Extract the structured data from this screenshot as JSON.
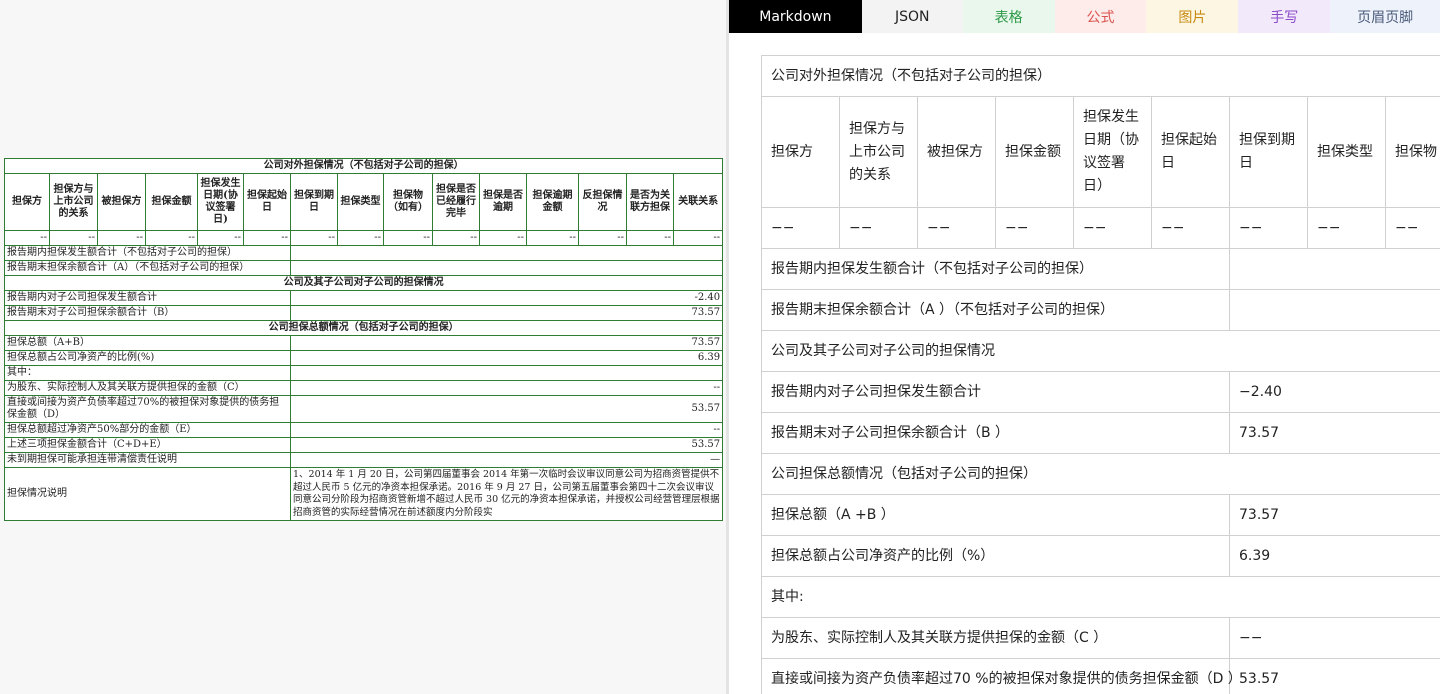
{
  "left": {
    "title": "公司对外担保情况（不包括对子公司的担保）",
    "headers": [
      "担保方",
      "担保方与上市公司的关系",
      "被担保方",
      "担保金额",
      "担保发生日期(协议签署日)",
      "担保起始日",
      "担保到期日",
      "担保类型",
      "担保物（如有）",
      "担保是否已经履行完毕",
      "担保是否逾期",
      "担保逾期金额",
      "反担保情况",
      "是否为关联方担保",
      "关联关系"
    ],
    "dash": "--",
    "rows": [
      {
        "label": "报告期内担保发生额合计（不包括对子公司的担保）",
        "value": ""
      },
      {
        "label": "报告期末担保余额合计（A）（不包括对子公司的担保）",
        "value": ""
      }
    ],
    "sub_title": "公司及其子公司对子公司的担保情况",
    "sub_rows": [
      {
        "label": "报告期内对子公司担保发生额合计",
        "value": "-2.40"
      },
      {
        "label": "报告期末对子公司担保余额合计（B）",
        "value": "73.57"
      }
    ],
    "total_title": "公司担保总额情况（包括对子公司的担保）",
    "total_rows": [
      {
        "label": "担保总额（A+B）",
        "value": "73.57"
      },
      {
        "label": "担保总额占公司净资产的比例(%)",
        "value": "6.39"
      },
      {
        "label": "其中：",
        "value": ""
      },
      {
        "label": "为股东、实际控制人及其关联方提供担保的金额（C）",
        "value": "--"
      },
      {
        "label": "直接或间接为资产负债率超过70%的被担保对象提供的债务担保金额（D）",
        "value": "53.57"
      },
      {
        "label": "担保总额超过净资产50%部分的金额（E）",
        "value": "--"
      },
      {
        "label": "上述三项担保金额合计（C+D+E）",
        "value": "53.57"
      },
      {
        "label": "未到期担保可能承担连带清偿责任说明",
        "value": "—"
      }
    ],
    "note_label": "担保情况说明",
    "note_text": "1、2014 年 1 月 20 日，公司第四届董事会 2014 年第一次临时会议审议同意公司为招商资管提供不超过人民币 5 亿元的净资本担保承诺。2016 年 9 月 27 日，公司第五届董事会第四十二次会议审议同意公司分阶段为招商资管新增不超过人民币 30 亿元的净资本担保承诺，并授权公司经营管理层根据招商资管的实际经营情况在前述额度内分阶段实"
  },
  "tabs": [
    {
      "label": "Markdown",
      "active": true
    },
    {
      "label": "JSON"
    },
    {
      "label": "表格"
    },
    {
      "label": "公式"
    },
    {
      "label": "图片"
    },
    {
      "label": "手写"
    },
    {
      "label": "页眉页脚"
    }
  ],
  "result": {
    "title": "公司对外担保情况（不包括对子公司的担保）",
    "headers": [
      "担保方",
      "担保方与上市公司的关系",
      "被担保方",
      "担保金额",
      "担保发生日期（协议签署日）",
      "担保起始日",
      "担保到期日",
      "担保类型",
      "担保物（如"
    ],
    "dash": "−−",
    "rows": [
      {
        "label": "报告期内担保发生额合计（不包括对子公司的担保）",
        "value": ""
      },
      {
        "label": "报告期末担保余额合计（A ）（不包括对子公司的担保）",
        "value": ""
      },
      {
        "label": "公司及其子公司对子公司的担保情况",
        "value": null
      },
      {
        "label": "报告期内对子公司担保发生额合计",
        "value": "−2.40"
      },
      {
        "label": "报告期末对子公司担保余额合计（B ）",
        "value": "73.57"
      },
      {
        "label": "公司担保总额情况（包括对子公司的担保）",
        "value": null
      },
      {
        "label": "担保总额（A +B ）",
        "value": "73.57"
      },
      {
        "label": "担保总额占公司净资产的比例（%）",
        "value": "6.39"
      },
      {
        "label": "其中:",
        "value": null
      },
      {
        "label": "为股东、实际控制人及其关联方提供担保的金额（C ）",
        "value": "−−"
      },
      {
        "label": "直接或间接为资产负债率超过70 %的被担保对象提供的债务担保金额（D ）",
        "value": "53.57"
      }
    ]
  }
}
